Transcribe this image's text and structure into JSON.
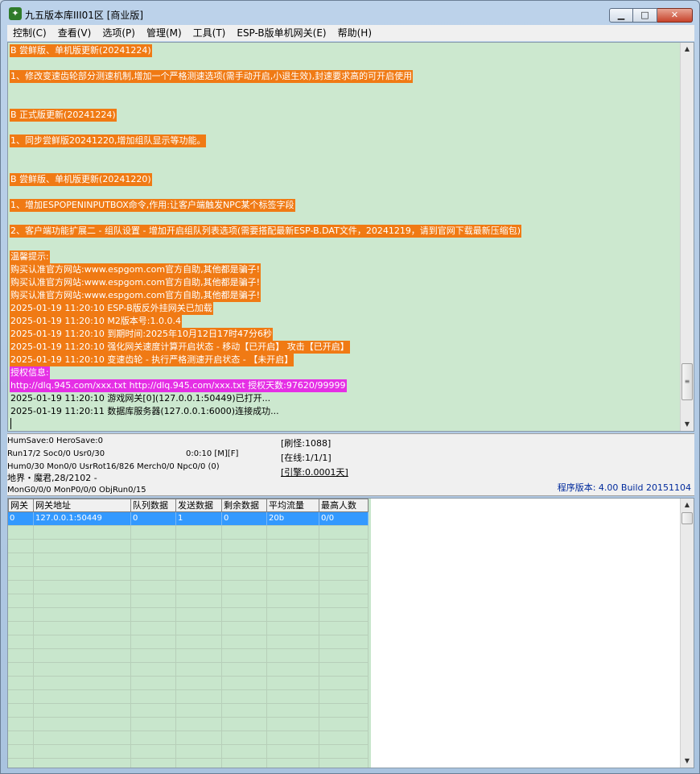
{
  "window": {
    "title": "九五版本库III01区 [商业版]",
    "buttons": {
      "minimize": "▁",
      "maximize": "□",
      "close": "✕"
    }
  },
  "menu": [
    "控制(C)",
    "查看(V)",
    "选项(P)",
    "管理(M)",
    "工具(T)",
    "ESP-B版单机网关(E)",
    "帮助(H)"
  ],
  "log": [
    {
      "text": "B 尝鲜版、单机版更新(20241224)",
      "style": "orange"
    },
    {
      "text": "1、修改变速齿轮部分测速机制,增加一个严格测速选项(需手动开启,小退生效),封速要求高的可开启使用",
      "style": "orange"
    },
    {
      "text": "B 正式版更新(20241224)",
      "style": "orange"
    },
    {
      "text": "1、同步尝鲜版20241220,增加组队显示等功能。",
      "style": "orange"
    },
    {
      "text": "B 尝鲜版、单机版更新(20241220)",
      "style": "orange"
    },
    {
      "text": "1、增加ESPOPENINPUTBOX命令,作用:让客户端触发NPC某个标签字段",
      "style": "orange"
    },
    {
      "text": "2、客户端功能扩展二 - 组队设置 - 增加开启组队列表选项(需要搭配最新ESP-B.DAT文件，20241219，请到官网下载最新压缩包)",
      "style": "orange"
    },
    {
      "text": "温馨提示:",
      "style": "orange"
    },
    {
      "text": "购买认准官方网站:www.espgom.com官方自助,其他都是骗子!",
      "style": "orange"
    },
    {
      "text": "购买认准官方网站:www.espgom.com官方自助,其他都是骗子!",
      "style": "orange"
    },
    {
      "text": "购买认准官方网站:www.espgom.com官方自助,其他都是骗子!",
      "style": "orange"
    },
    {
      "text": "2025-01-19 11:20:10 ESP-B版反外挂网关已加载",
      "style": "orange"
    },
    {
      "text": "2025-01-19 11:20:10 M2版本号:1.0.0.4",
      "style": "orange"
    },
    {
      "text": "2025-01-19 11:20:10 到期时间:2025年10月12日17时47分6秒",
      "style": "orange"
    },
    {
      "text": "2025-01-19 11:20:10 强化网关速度计算开启状态 - 移动【已开启】 攻击【已开启】",
      "style": "orange"
    },
    {
      "text": "2025-01-19 11:20:10 变速齿轮 - 执行严格测速开启状态 - 【未开启】",
      "style": "orange"
    },
    {
      "text": "授权信息:",
      "style": "magenta"
    },
    {
      "text": "http://dlq.945.com/xxx.txt http://dlq.945.com/xxx.txt 授权天数:97620/99999",
      "style": "magenta"
    },
    {
      "text": "2025-01-19 11:20:10 游戏网关[0](127.0.0.1:50449)已打开...",
      "style": "plain"
    },
    {
      "text": "2025-01-19 11:20:11 数据库服务器(127.0.0.1:6000)连接成功...",
      "style": "plain"
    }
  ],
  "status": {
    "line1": "HumSave:0 HeroSave:0",
    "line2": "Run17/2 Soc0/0 Usr0/30",
    "time": "0:0:10 [M][F]",
    "line3": "Hum0/30 Mon0/0 UsrRot16/826 Merch0/0 Npc0/0 (0)",
    "line4": "地界・魔君,28/2102 -",
    "line5": "MonG0/0/0 MonP0/0/0 ObjRun0/15",
    "refresh": "[刷怪:1088]",
    "online": "[在线:1/1/1]",
    "engine": "[引擎:0.0001天]",
    "version": "程序版本: 4.00 Build 20151104"
  },
  "grid": {
    "columns": [
      "网关",
      "网关地址",
      "队列数据",
      "发送数据",
      "剩余数据",
      "平均流量",
      "最高人数"
    ],
    "rows": [
      [
        "0",
        "127.0.0.1:50449",
        "0",
        "1",
        "0",
        "20b",
        "0/0"
      ]
    ]
  }
}
